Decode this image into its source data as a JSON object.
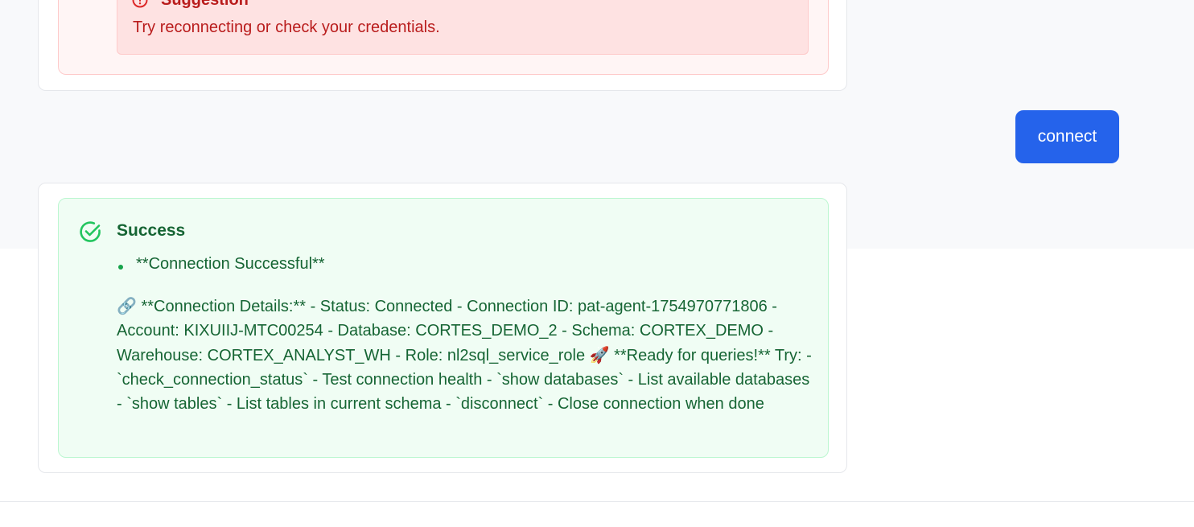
{
  "error_alert": {
    "suggestion_title": "Suggestion",
    "suggestion_text": "Try reconnecting or check your credentials.",
    "colors": {
      "background": "#fee2e2",
      "text": "#b91c1c"
    },
    "icon": "alert-circle-icon"
  },
  "user_message": {
    "text": "connect",
    "color": "#2563eb"
  },
  "success_alert": {
    "title": "Success",
    "icon": "check-circle-icon",
    "bullet": "**Connection Successful**",
    "details": {
      "link_emoji": "🔗",
      "part1": " **Connection Details:** - Status: Connected - Connection ID: pat-agent-1754970771806 - Account: KIXUIIJ-MTC00254 - Database: CORTES_DEMO_2 - Schema: CORTEX_DEMO - Warehouse: CORTEX_ANALYST_WH - Role: nl2sql_service_role ",
      "rocket_emoji": "🚀",
      "part2": " **Ready for queries!** Try: - `check_connection_status` - Test connection health - `show databases` - List available databases - `show tables` - List tables in current schema - `disconnect` - Close connection when done"
    },
    "colors": {
      "background": "#f0fdf4",
      "text": "#166534",
      "accent": "#22c55e"
    }
  }
}
